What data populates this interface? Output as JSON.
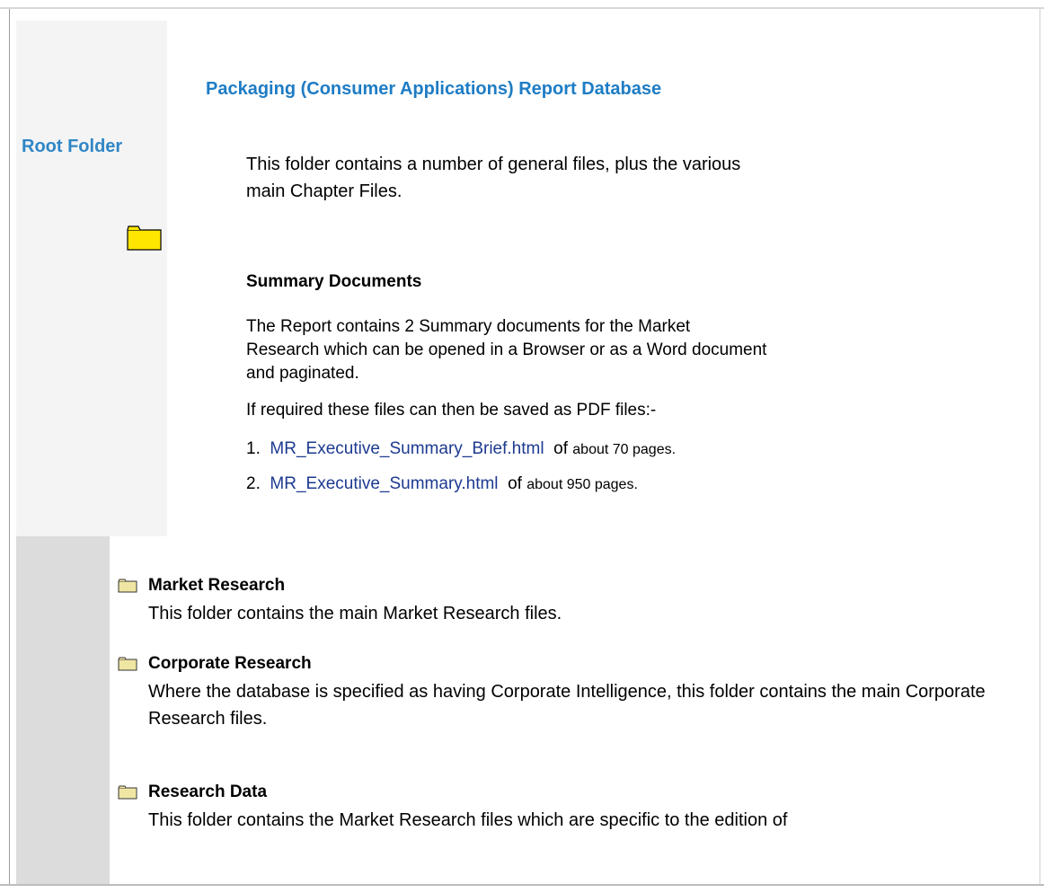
{
  "sidebar": {
    "label": "Root Folder",
    "icon": "folder-icon"
  },
  "main": {
    "title": "Packaging (Consumer Applications) Report Database",
    "intro": "This folder contains a number of general files, plus the various main Chapter Files.",
    "summary": {
      "heading": "Summary Documents",
      "text": "The Report contains 2 Summary documents for the Market Research which can be opened in a Browser or as a Word document and paginated.",
      "pdf_note": "If required these files can then be saved as PDF files:-",
      "items": [
        {
          "number": "1.",
          "link": "MR_Executive_Summary_Brief.html",
          "of": "of",
          "pages": "about 70 pages."
        },
        {
          "number": "2.",
          "link": "MR_Executive_Summary.html",
          "of": "of",
          "pages": "about 950 pages."
        }
      ]
    }
  },
  "folders": [
    {
      "name": "Market Research",
      "description": "This folder contains the main Market Research files.",
      "icon": "folder-icon"
    },
    {
      "name": "Corporate Research",
      "description": "Where the database is specified as having Corporate Intelligence, this folder contains the main Corporate Research files.",
      "icon": "folder-icon"
    },
    {
      "name": "Research Data",
      "description": "This folder contains the Market Research files which are specific to the edition of",
      "icon": "folder-icon"
    }
  ],
  "colors": {
    "title_blue": "#1e7cc4",
    "sidebar_label_blue": "#2f86c6",
    "link_blue": "#1c3a90",
    "folder_yellow": "#ffe600",
    "small_folder_fill": "#f0e6a4"
  }
}
